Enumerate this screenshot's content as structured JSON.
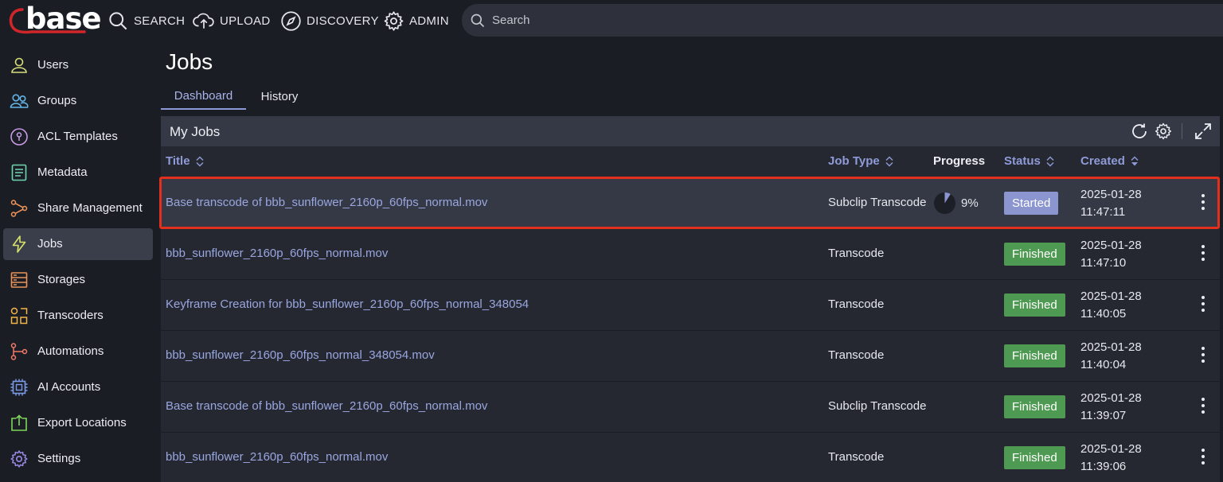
{
  "app": {
    "logo_text": "base"
  },
  "topnav": [
    {
      "id": "search",
      "label": "SEARCH"
    },
    {
      "id": "upload",
      "label": "UPLOAD"
    },
    {
      "id": "discovery",
      "label": "DISCOVERY"
    },
    {
      "id": "admin",
      "label": "ADMIN"
    }
  ],
  "search": {
    "placeholder": "Search"
  },
  "sidebar": {
    "items": [
      {
        "label": "Users",
        "icon": "user-icon",
        "color": "#d7e07a"
      },
      {
        "label": "Groups",
        "icon": "groups-icon",
        "color": "#63b5e8"
      },
      {
        "label": "ACL Templates",
        "icon": "acl-icon",
        "color": "#c79ae6"
      },
      {
        "label": "Metadata",
        "icon": "metadata-icon",
        "color": "#6fd6b0"
      },
      {
        "label": "Share Management",
        "icon": "share-icon",
        "color": "#f0965a"
      },
      {
        "label": "Jobs",
        "icon": "lightning-icon",
        "color": "#d8e36a",
        "active": true
      },
      {
        "label": "Storages",
        "icon": "storage-icon",
        "color": "#e8935a"
      },
      {
        "label": "Transcoders",
        "icon": "transcoder-icon",
        "color": "#f2b54a"
      },
      {
        "label": "Automations",
        "icon": "automation-icon",
        "color": "#f07a6a"
      },
      {
        "label": "AI Accounts",
        "icon": "ai-chip-icon",
        "color": "#7a9ae8"
      },
      {
        "label": "Export Locations",
        "icon": "export-icon",
        "color": "#7fd65a"
      },
      {
        "label": "Settings",
        "icon": "settings-icon",
        "color": "#9a8ae8"
      }
    ]
  },
  "page": {
    "title": "Jobs"
  },
  "tabs": [
    {
      "label": "Dashboard",
      "active": true
    },
    {
      "label": "History",
      "active": false
    }
  ],
  "panel": {
    "title": "My Jobs",
    "columns": {
      "title": "Title",
      "job_type": "Job Type",
      "progress": "Progress",
      "status": "Status",
      "created": "Created"
    },
    "rows": [
      {
        "title": "Base transcode of bbb_sunflower_2160p_60fps_normal.mov",
        "job_type": "Subclip Transcode",
        "progress": 9,
        "progress_label": "9%",
        "status": "Started",
        "date": "2025-01-28",
        "time": "11:47:11",
        "highlighted": true
      },
      {
        "title": "bbb_sunflower_2160p_60fps_normal.mov",
        "job_type": "Transcode",
        "progress": null,
        "progress_label": "",
        "status": "Finished",
        "date": "2025-01-28",
        "time": "11:47:10"
      },
      {
        "title": "Keyframe Creation for bbb_sunflower_2160p_60fps_normal_348054",
        "job_type": "Transcode",
        "progress": null,
        "progress_label": "",
        "status": "Finished",
        "date": "2025-01-28",
        "time": "11:40:05"
      },
      {
        "title": "bbb_sunflower_2160p_60fps_normal_348054.mov",
        "job_type": "Transcode",
        "progress": null,
        "progress_label": "",
        "status": "Finished",
        "date": "2025-01-28",
        "time": "11:40:04"
      },
      {
        "title": "Base transcode of bbb_sunflower_2160p_60fps_normal.mov",
        "job_type": "Subclip Transcode",
        "progress": null,
        "progress_label": "",
        "status": "Finished",
        "date": "2025-01-28",
        "time": "11:39:07"
      },
      {
        "title": "bbb_sunflower_2160p_60fps_normal.mov",
        "job_type": "Transcode",
        "progress": null,
        "progress_label": "",
        "status": "Finished",
        "date": "2025-01-28",
        "time": "11:39:06"
      }
    ]
  },
  "colors": {
    "accent": "#8d99d6",
    "started": "#8b95cf",
    "finished": "#4f9a52",
    "highlight": "#e2301d"
  }
}
